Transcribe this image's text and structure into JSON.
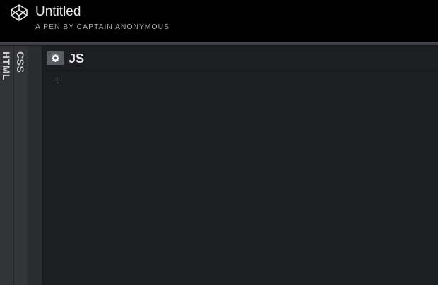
{
  "header": {
    "logo_icon": "codepen-logo-icon",
    "title": "Untitled",
    "subtitle": "A PEN BY CAPTAIN ANONYMOUS"
  },
  "side_tabs": [
    {
      "label": "HTML"
    },
    {
      "label": "CSS"
    }
  ],
  "editor": {
    "settings_icon": "gear-icon",
    "title": "JS",
    "line_numbers": [
      "1"
    ]
  },
  "colors": {
    "header_bg": "#000000",
    "editor_bg": "#1d1e22",
    "side_tab_bg": "#333438",
    "settings_btn_bg": "#5a5c63"
  }
}
